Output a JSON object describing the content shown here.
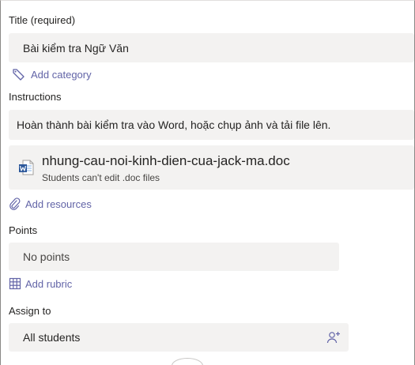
{
  "title": {
    "label": "Title (required)",
    "value": "Bài kiểm tra Ngữ Văn"
  },
  "category": {
    "link": "Add category"
  },
  "instructions": {
    "label": "Instructions",
    "value": "Hoàn thành bài kiểm tra vào Word, hoặc chụp ảnh và tải file lên."
  },
  "attachment": {
    "filename": "nhung-cau-noi-kinh-dien-cua-jack-ma.doc",
    "note": "Students can't edit .doc files",
    "icon": "word-doc-icon"
  },
  "resources": {
    "link": "Add resources"
  },
  "points": {
    "label": "Points",
    "value": "No points"
  },
  "rubric": {
    "link": "Add rubric"
  },
  "assign": {
    "label": "Assign to",
    "value": "All students"
  },
  "colors": {
    "accent": "#6264a7",
    "field_bg": "#f3f2f1",
    "word_blue": "#2b579a"
  }
}
